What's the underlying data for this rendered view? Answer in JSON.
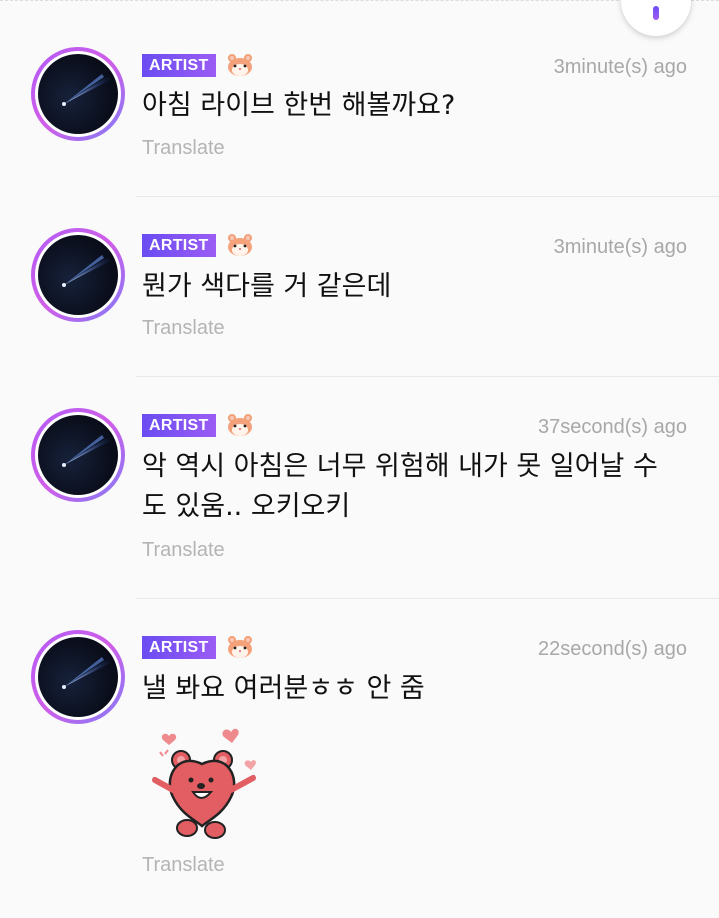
{
  "posts": [
    {
      "badge": "ARTIST",
      "badge_icon": "hamster-icon",
      "time": "3minute(s) ago",
      "message": "아침 라이브 한번 해볼까요?",
      "translate": "Translate"
    },
    {
      "badge": "ARTIST",
      "badge_icon": "hamster-icon",
      "time": "3minute(s) ago",
      "message": " 뭔가 색다를 거 같은데",
      "translate": "Translate"
    },
    {
      "badge": "ARTIST",
      "badge_icon": "hamster-icon",
      "time": "37second(s) ago",
      "message": "악 역시 아침은 너무 위험해 내가 못 일어날 수도 있움.. 오키오키",
      "translate": "Translate"
    },
    {
      "badge": "ARTIST",
      "badge_icon": "hamster-icon",
      "time": "22second(s) ago",
      "message": "낼 봐요 여러분ㅎㅎ 안 줌",
      "sticker": "bear-sticker",
      "translate": "Translate"
    }
  ],
  "colors": {
    "badge_gradient_start": "#6a4cf2",
    "badge_gradient_end": "#9b5cf4",
    "avatar_ring_start": "#b25bf6",
    "avatar_ring_end": "#7f7cf7",
    "timestamp": "#a8a8a8",
    "translate": "#b4b4b4",
    "background": "#fafafa"
  }
}
